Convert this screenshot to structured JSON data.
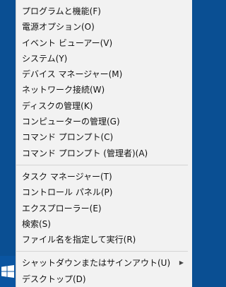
{
  "menu": {
    "groups": [
      {
        "items": [
          {
            "label": "プログラムと機能(F)"
          },
          {
            "label": "電源オプション(O)"
          },
          {
            "label": "イベント ビューアー(V)"
          },
          {
            "label": "システム(Y)"
          },
          {
            "label": "デバイス マネージャー(M)"
          },
          {
            "label": "ネットワーク接続(W)"
          },
          {
            "label": "ディスクの管理(K)"
          },
          {
            "label": "コンピューターの管理(G)"
          },
          {
            "label": "コマンド プロンプト(C)"
          },
          {
            "label": "コマンド プロンプト (管理者)(A)"
          }
        ]
      },
      {
        "items": [
          {
            "label": "タスク マネージャー(T)"
          },
          {
            "label": "コントロール パネル(P)"
          },
          {
            "label": "エクスプローラー(E)"
          },
          {
            "label": "検索(S)"
          },
          {
            "label": "ファイル名を指定して実行(R)"
          }
        ]
      },
      {
        "items": [
          {
            "label": "シャットダウンまたはサインアウト(U)",
            "submenu": true,
            "arrow_icon": "chevron-right-icon"
          },
          {
            "label": "デスクトップ(D)"
          }
        ]
      }
    ]
  },
  "taskbar": {
    "start_icon": "windows-logo-icon"
  },
  "colors": {
    "menu_background": "#f2f2f2",
    "separator": "#d4d4d4",
    "desktop": "#0a4f93",
    "windows_logo": "#ffffff"
  }
}
